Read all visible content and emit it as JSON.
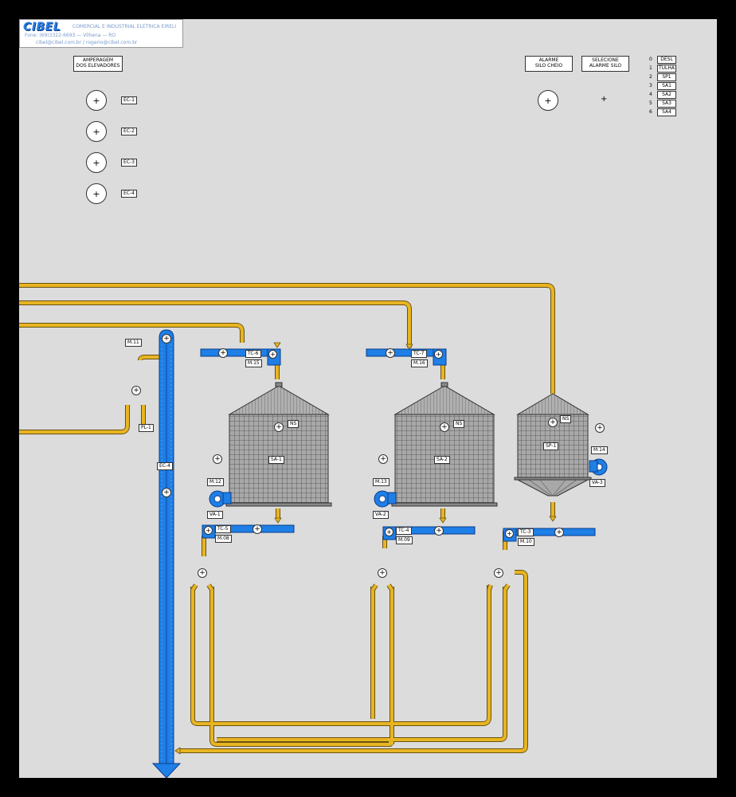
{
  "company": {
    "brand": "CIBEL",
    "subtitle": "COMERCIAL E INDUSTRIAL ELÉTRICA EIRELI",
    "phone_line": "Fone: (69)3322-6693   —   Vilhena   —   RO",
    "email_line": "cibel@cibel.com.br  /  rogerio@cibel.com.br"
  },
  "amperage_panel": {
    "title_line1": "AMPERAGEM",
    "title_line2": "DOS ELEVADORES",
    "items": [
      {
        "tag": "EC-1",
        "symbol": "+"
      },
      {
        "tag": "EC-2",
        "symbol": "+"
      },
      {
        "tag": "EC-3",
        "symbol": "+"
      },
      {
        "tag": "EC-4",
        "symbol": "+"
      }
    ]
  },
  "alarm": {
    "silo_full_line1": "ALARME",
    "silo_full_line2": "SILO CHEIO",
    "select_line1": "SELECIONE",
    "select_line2": "ALARME SILO",
    "indicator_symbol": "+",
    "select_symbol": "+",
    "options": [
      {
        "num": "0",
        "label": "DESL"
      },
      {
        "num": "1",
        "label": "TULHA"
      },
      {
        "num": "2",
        "label": "SP1"
      },
      {
        "num": "3",
        "label": "SA1"
      },
      {
        "num": "4",
        "label": "SA2"
      },
      {
        "num": "5",
        "label": "SA3"
      },
      {
        "num": "6",
        "label": "SA4"
      }
    ]
  },
  "equipment": {
    "elevator": {
      "motor": "M.11",
      "tag": "EC-4"
    },
    "pl": {
      "tag": "PL-1"
    },
    "silos": [
      {
        "tag": "SA-1",
        "level_sensor": "NS"
      },
      {
        "tag": "SA-2",
        "level_sensor": "NS"
      },
      {
        "tag": "SP-1",
        "level_sensor": "NS"
      }
    ],
    "top_conveyors": [
      {
        "tag": "TC-6",
        "motor": "M.15"
      },
      {
        "tag": "TC-7",
        "motor": "M.16"
      }
    ],
    "bottom_conveyors": [
      {
        "tag": "TC-5",
        "motor": "M.08"
      },
      {
        "tag": "TC-4",
        "motor": "M.09"
      },
      {
        "tag": "TC-3",
        "motor": "M.10"
      }
    ],
    "fans": [
      {
        "tag": "VA-1",
        "motor": "M.12"
      },
      {
        "tag": "VA-2",
        "motor": "M.13"
      },
      {
        "tag": "VA-3",
        "motor": "M.14"
      }
    ],
    "symbol": "+"
  },
  "colors": {
    "background": "#dcdcdc",
    "grain_pipe": "#e8b522",
    "grain_pipe_outline": "#6b5210",
    "conveyor_blue": "#1e7fe6",
    "silo_gray": "#a8a8a8"
  }
}
